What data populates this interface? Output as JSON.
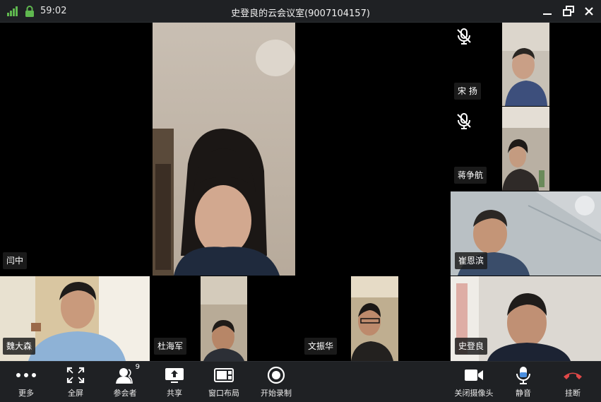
{
  "titlebar": {
    "timer": "59:02",
    "title": "史登良的云会议室(9007104157)"
  },
  "participants": [
    {
      "name": "闫中"
    },
    {
      "name": "魏大森"
    },
    {
      "name": "杜海军"
    },
    {
      "name": "文振华"
    },
    {
      "name": "宋 扬",
      "muted": true
    },
    {
      "name": "蒋争航",
      "muted": true
    },
    {
      "name": "崔恩滨"
    },
    {
      "name": "史登良"
    }
  ],
  "toolbar": {
    "more": "更多",
    "fullscreen": "全屏",
    "participants": "参会者",
    "participants_count": "9",
    "share": "共享",
    "layout": "窗口布局",
    "record": "开始录制",
    "camera_off": "关闭摄像头",
    "mute": "静音",
    "hangup": "挂断"
  },
  "colors": {
    "hangup": "#e04848",
    "mic": "#4a8fe0",
    "signal": "#5fb84f"
  }
}
